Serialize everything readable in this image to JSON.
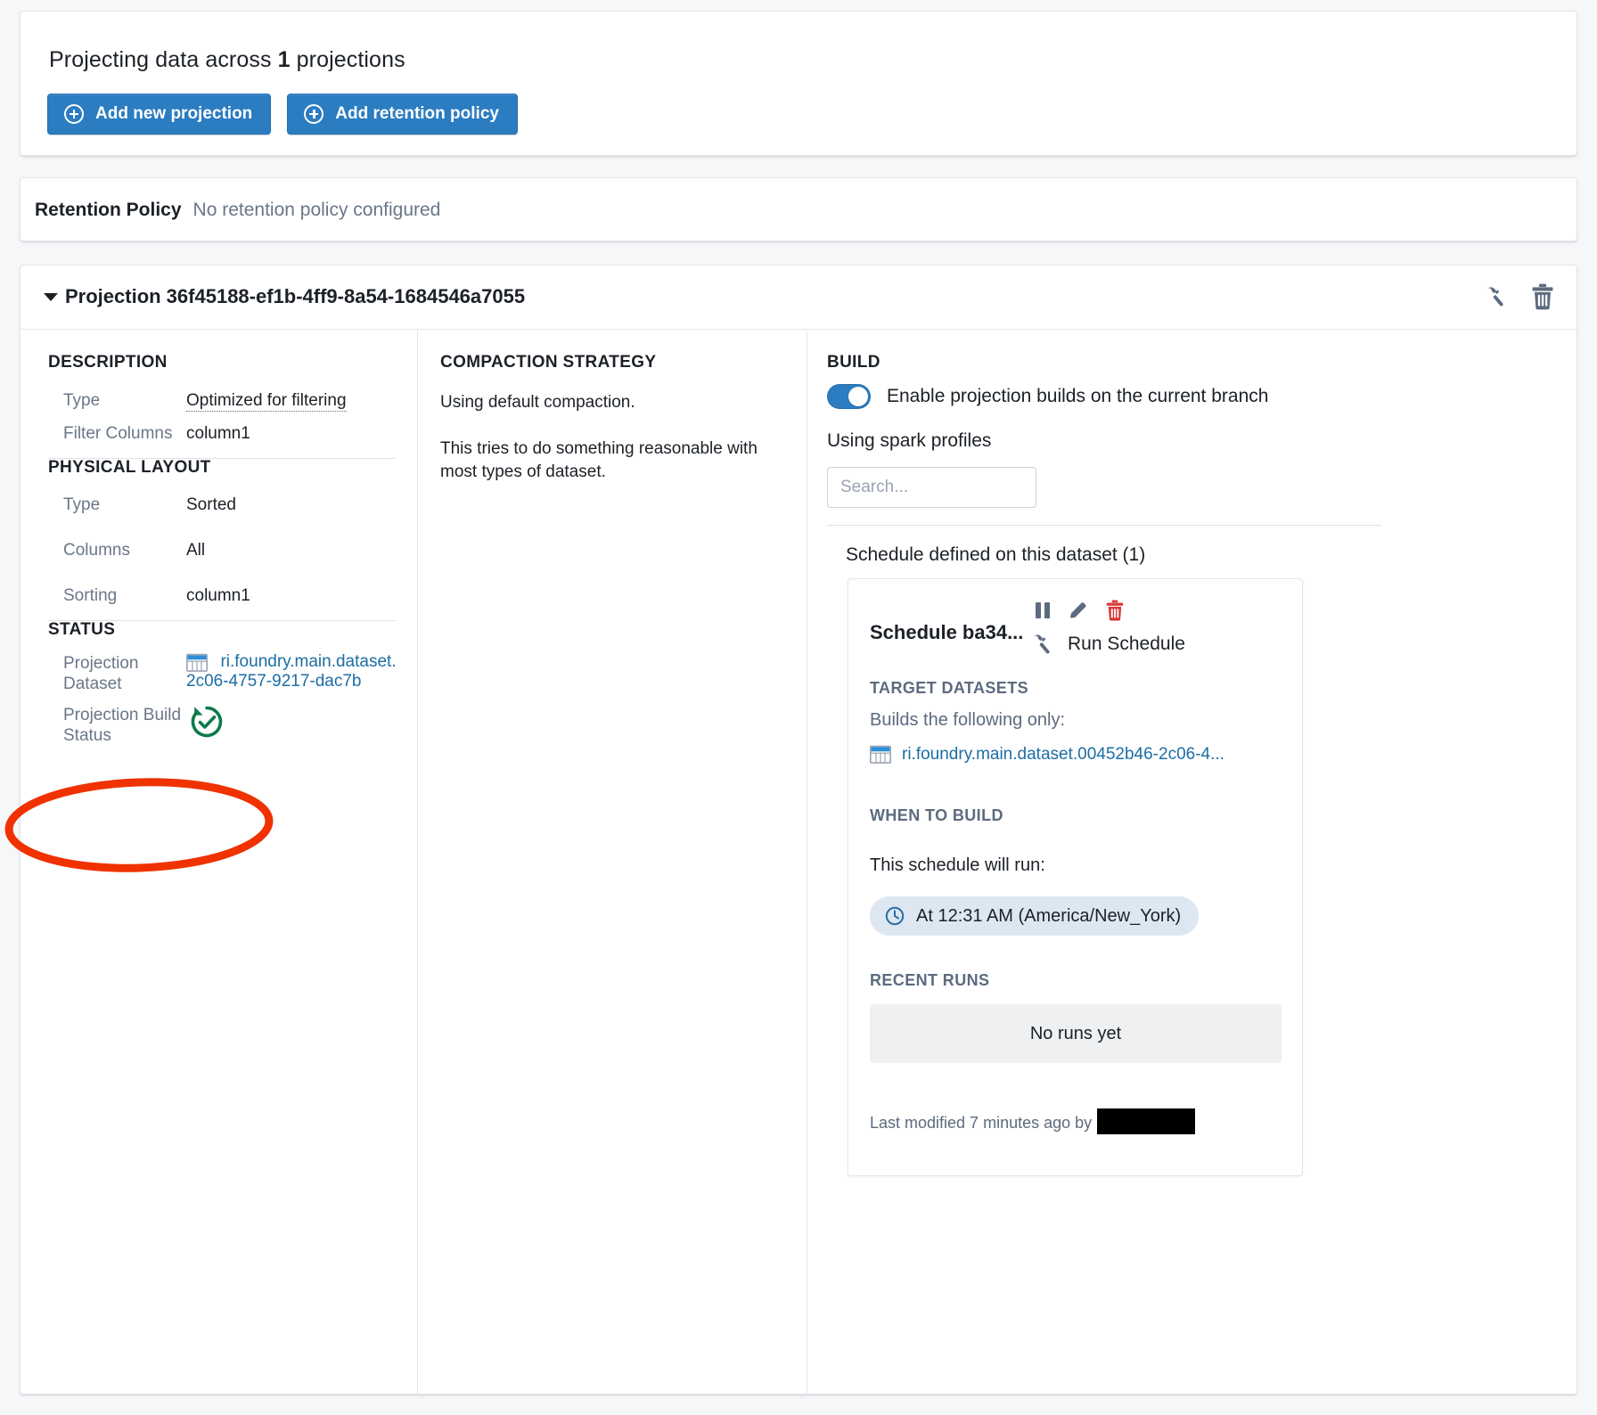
{
  "header": {
    "title_prefix": "Projecting data across ",
    "count": "1",
    "title_suffix": " projections",
    "add_projection_label": "Add new projection",
    "add_retention_label": "Add retention policy"
  },
  "retention": {
    "label": "Retention Policy",
    "value": "No retention policy configured"
  },
  "projection": {
    "title": "Projection 36f45188-ef1b-4ff9-8a54-1684546a7055",
    "build_icon_name": "hammer-icon",
    "delete_icon_name": "trash-icon"
  },
  "description": {
    "heading": "DESCRIPTION",
    "rows": [
      {
        "key": "Type",
        "value": "Optimized for filtering"
      },
      {
        "key": "Filter Columns",
        "value": "column1"
      }
    ]
  },
  "physical_layout": {
    "heading": "PHYSICAL LAYOUT",
    "rows": [
      {
        "key": "Type",
        "value": "Sorted"
      },
      {
        "key": "Columns",
        "value": "All"
      },
      {
        "key": "Sorting",
        "value": "column1"
      }
    ]
  },
  "status": {
    "heading": "STATUS",
    "dataset_key_line1": "Projection",
    "dataset_key_line2": "Dataset",
    "dataset_link_line1": "ri.foundry.main.dataset.",
    "dataset_link_line2": "2c06-4757-9217-dac7b",
    "build_status_key_line1": "Projection Build",
    "build_status_key_line2": "Status",
    "build_status_icon": "refresh-check-success-icon"
  },
  "compaction": {
    "heading": "COMPACTION STRATEGY",
    "line1": "Using default compaction.",
    "line2": "This tries to do something reasonable with most types of dataset."
  },
  "build": {
    "heading": "BUILD",
    "toggle_label": "Enable projection builds on the current branch",
    "toggle_on": true,
    "spark_label": "Using spark profiles",
    "search_placeholder": "Search...",
    "search_value": "",
    "schedule_count_label": "Schedule defined on this dataset (1)"
  },
  "schedule": {
    "name": "Schedule ba34...",
    "pause_icon": "pause-icon",
    "edit_icon": "pencil-icon",
    "delete_icon": "trash-icon",
    "run_label": "Run Schedule",
    "run_icon": "hammer-icon",
    "target_heading": "TARGET DATASETS",
    "target_sub": "Builds the following only:",
    "target_dataset": "ri.foundry.main.dataset.00452b46-2c06-4...",
    "when_heading": "WHEN TO BUILD",
    "when_sub": "This schedule will run:",
    "when_pill": "At 12:31 AM (America/New_York)",
    "when_pill_icon": "clock-icon",
    "recent_heading": "RECENT RUNS",
    "no_runs": "No runs yet",
    "last_modified": "Last modified 7 minutes ago by"
  },
  "annotation": {
    "shape": "ellipse",
    "color": "#f03200",
    "targets": "projection-build-status-row"
  },
  "colors": {
    "accent_blue": "#2b7cc1",
    "link_blue": "#1c6ea4",
    "muted_text": "#6a7689",
    "dark_text": "#1c2127",
    "success_green": "#0d7a4a",
    "danger_red": "#db3737",
    "annotation_red": "#f03200"
  }
}
